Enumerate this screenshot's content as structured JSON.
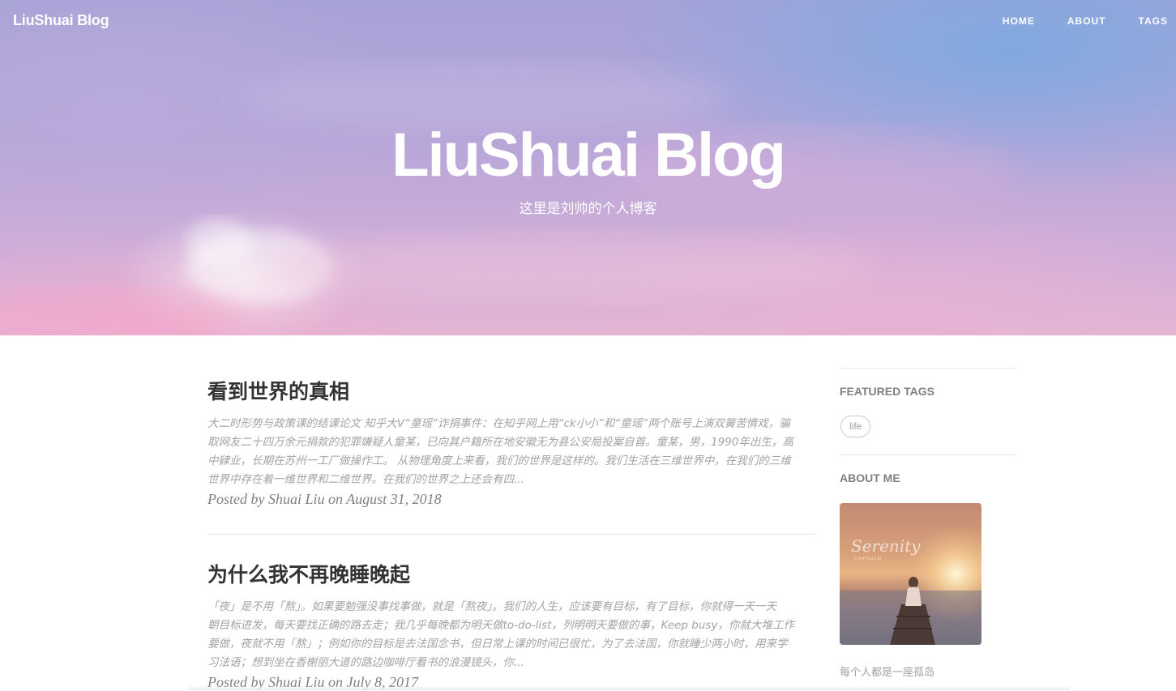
{
  "nav": {
    "brand": "LiuShuai Blog",
    "links": [
      "HOME",
      "ABOUT",
      "TAGS"
    ]
  },
  "hero": {
    "title": "LiuShuai Blog",
    "subtitle": "这里是刘帅的个人博客"
  },
  "posts": [
    {
      "title": "看到世界的真相",
      "excerpt_lines": [
        "大二时形势与政策课的结课论文 知乎大V“童瑶”诈捐事件：在知乎网上用“ck小小”和“童瑶”两个账号上演双簧苦情戏，骗",
        "取网友二十四万余元捐款的犯罪嫌疑人童某，已向其户籍所在地安徽无为县公安局投案自首。童某，男，1990年出生，高",
        "中肄业，长期在苏州一工厂做操作工。 从物理角度上来看，我们的世界是这样的。我们生活在三维世界中，在我们的三维",
        "世界中存在着一维世界和二维世界。在我们的世界之上还会有四..."
      ],
      "meta": "Posted by Shuai Liu on August 31, 2018"
    },
    {
      "title": "为什么我不再晚睡晚起",
      "excerpt_lines": [
        "「夜」是不用「熬」。如果要勉强没事找事做，就是「熬夜」。我们的人生，应该要有目标，有了目标，你就得一天一天",
        "朝目标进发，每天要找正确的路去走；我几乎每晚都为明天做to-do-list，列明明天要做的事，Keep busy，你就大堆工作",
        "要做，夜就不用「熬」；例如你的目标是去法国念书，但日常上课的时间已很忙，为了去法国，你就睡少两小时，用来学",
        "习法语；想到坐在香榭丽大道的路边咖啡厅看书的浪漫镜头，你..."
      ],
      "meta": "Posted by Shuai Liu on July 8, 2017"
    }
  ],
  "sidebar": {
    "featured_tags_heading": "FEATURED TAGS",
    "tags": [
      "life"
    ],
    "about_heading": "ABOUT ME",
    "about_image_text": "Serenity",
    "about_image_subtext": "CAPOZIO",
    "about_caption": "每个人都是一座孤岛"
  }
}
